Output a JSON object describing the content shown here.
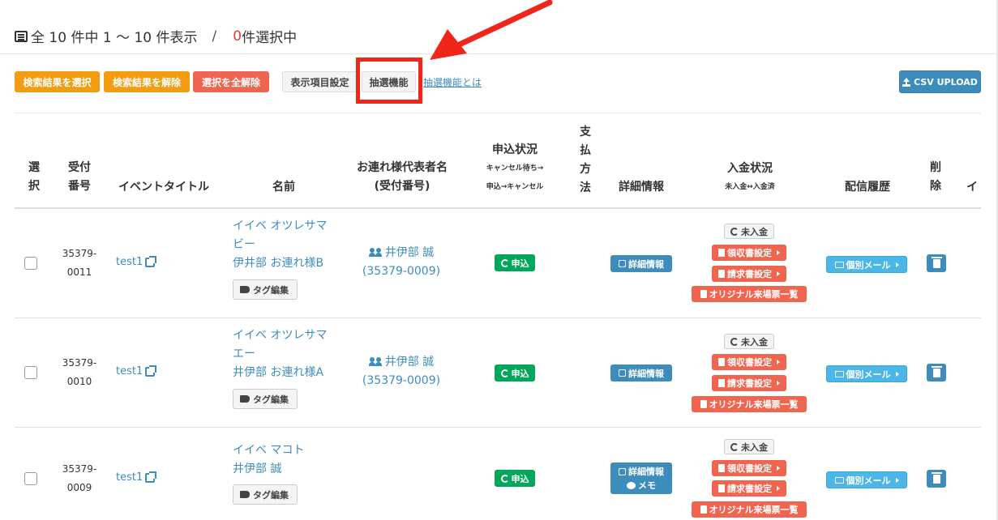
{
  "summary": {
    "text_total": "全 10 件中 1 〜 10 件表示",
    "sep": "/",
    "selected_count": "0",
    "selected_suffix": "件選択中"
  },
  "toolbar": {
    "select_results": "検索結果を選択",
    "deselect_results": "検索結果を解除",
    "deselect_all": "選択を全解除",
    "display_settings": "表示項目設定",
    "lottery": "抽選機能",
    "lottery_link": "抽選機能とは",
    "csv_upload": "CSV UPLOAD"
  },
  "table": {
    "headers": {
      "select": [
        "選",
        "択"
      ],
      "receipt": [
        "受付",
        "番号"
      ],
      "event_title": "イベントタイトル",
      "name": "名前",
      "companion": [
        "お連れ様代表者名",
        "(受付番号)"
      ],
      "status": "申込状況",
      "status_sub": [
        "キャンセル待ち→",
        "申込→キャンセル"
      ],
      "payment": [
        "支",
        "払",
        "方",
        "法"
      ],
      "details": "詳細情報",
      "deposit": "入金状況",
      "deposit_sub": "未入金↔入金済",
      "history": "配信履歴",
      "delete": [
        "削",
        "除"
      ],
      "more": "イ"
    },
    "rows": [
      {
        "receipt": [
          "35379-",
          "0011"
        ],
        "event": "test1",
        "name": [
          "イイベ オツレサマ",
          "ビー",
          "伊井部 お連れ様B"
        ],
        "tag": "タグ編集",
        "rep_name": "井伊部 誠",
        "rep_no": "(35379-0009)",
        "status": "申込",
        "details": "詳細情報",
        "details_memo": "",
        "unpaid": "未入金",
        "receipt_setting": "領収書設定",
        "invoice_setting": "請求書設定",
        "ticket_list": "オリジナル来場票一覧",
        "mail": "個別メール"
      },
      {
        "receipt": [
          "35379-",
          "0010"
        ],
        "event": "test1",
        "name": [
          "イイベ オツレサマ",
          "エー",
          "井伊部 お連れ様A"
        ],
        "tag": "タグ編集",
        "rep_name": "井伊部 誠",
        "rep_no": "(35379-0009)",
        "status": "申込",
        "details": "詳細情報",
        "details_memo": "",
        "unpaid": "未入金",
        "receipt_setting": "領収書設定",
        "invoice_setting": "請求書設定",
        "ticket_list": "オリジナル来場票一覧",
        "mail": "個別メール"
      },
      {
        "receipt": [
          "35379-",
          "0009"
        ],
        "event": "test1",
        "name": [
          "イイベ マコト",
          "井伊部 誠",
          ""
        ],
        "tag": "タグ編集",
        "rep_name": "",
        "rep_no": "",
        "status": "申込",
        "details": "詳細情報",
        "details_memo": "メモ",
        "unpaid": "未入金",
        "receipt_setting": "領収書設定",
        "invoice_setting": "請求書設定",
        "ticket_list": "オリジナル来場票一覧",
        "mail": "個別メール"
      }
    ]
  },
  "colors": {
    "accent_blue": "#3c8dbc",
    "orange": "#f39c12",
    "red": "#f0654f",
    "green": "#00a65a",
    "highlight": "#f0261b"
  },
  "icons": {
    "summary": "list-icon",
    "event_link": "external-link-icon",
    "tag": "tag-icon",
    "companion": "users-icon",
    "status": "refresh-icon",
    "details": "edit-icon",
    "mail": "envelope-icon",
    "delete": "trash-icon"
  }
}
